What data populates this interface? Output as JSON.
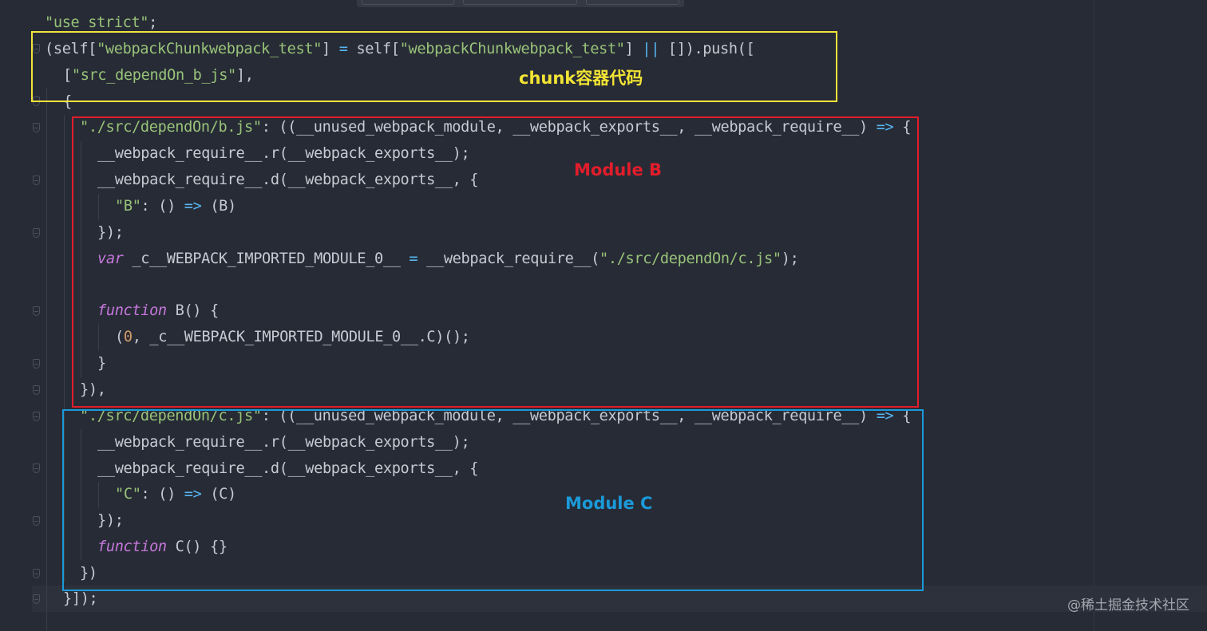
{
  "editor": {
    "lines": [
      [
        {
          "t": "\"use strict\"",
          "c": "str"
        },
        {
          "t": ";",
          "c": ""
        }
      ],
      [
        {
          "t": "(self[",
          "c": ""
        },
        {
          "t": "\"webpackChunkwebpack_test\"",
          "c": "str"
        },
        {
          "t": "] ",
          "c": ""
        },
        {
          "t": "=",
          "c": "op"
        },
        {
          "t": " self[",
          "c": ""
        },
        {
          "t": "\"webpackChunkwebpack_test\"",
          "c": "str"
        },
        {
          "t": "] ",
          "c": ""
        },
        {
          "t": "||",
          "c": "op"
        },
        {
          "t": " []).push([",
          "c": ""
        }
      ],
      [
        {
          "t": "[",
          "c": ""
        },
        {
          "t": "\"src_dependOn_b_js\"",
          "c": "str"
        },
        {
          "t": "],",
          "c": ""
        }
      ],
      [
        {
          "t": "{",
          "c": ""
        }
      ],
      [
        {
          "t": "\"./src/dependOn/b.js\"",
          "c": "str"
        },
        {
          "t": ": ((__unused_webpack_module, __webpack_exports__, __webpack_require__) ",
          "c": ""
        },
        {
          "t": "=>",
          "c": "op"
        },
        {
          "t": " {",
          "c": ""
        }
      ],
      [
        {
          "t": "__webpack_require__.r(__webpack_exports__);",
          "c": ""
        }
      ],
      [
        {
          "t": "__webpack_require__.d(__webpack_exports__, {",
          "c": ""
        }
      ],
      [
        {
          "t": "\"B\"",
          "c": "str"
        },
        {
          "t": ": () ",
          "c": ""
        },
        {
          "t": "=>",
          "c": "op"
        },
        {
          "t": " (B)",
          "c": ""
        }
      ],
      [
        {
          "t": "});",
          "c": ""
        }
      ],
      [
        {
          "t": "var",
          "c": "kw"
        },
        {
          "t": " _c__WEBPACK_IMPORTED_MODULE_0__ ",
          "c": ""
        },
        {
          "t": "=",
          "c": "op"
        },
        {
          "t": " __webpack_require__(",
          "c": ""
        },
        {
          "t": "\"./src/dependOn/c.js\"",
          "c": "str"
        },
        {
          "t": ");",
          "c": ""
        }
      ],
      [],
      [
        {
          "t": "function",
          "c": "kw"
        },
        {
          "t": " B() {",
          "c": ""
        }
      ],
      [
        {
          "t": "(",
          "c": ""
        },
        {
          "t": "0",
          "c": "num"
        },
        {
          "t": ", _c__WEBPACK_IMPORTED_MODULE_0__.C)();",
          "c": ""
        }
      ],
      [
        {
          "t": "}",
          "c": ""
        }
      ],
      [
        {
          "t": "}),",
          "c": ""
        }
      ],
      [
        {
          "t": "\"./src/dependOn/c.js\"",
          "c": "str"
        },
        {
          "t": ": ((__unused_webpack_module, __webpack_exports__, __webpack_require__) ",
          "c": ""
        },
        {
          "t": "=>",
          "c": "op"
        },
        {
          "t": " {",
          "c": ""
        }
      ],
      [
        {
          "t": "__webpack_require__.r(__webpack_exports__);",
          "c": ""
        }
      ],
      [
        {
          "t": "__webpack_require__.d(__webpack_exports__, {",
          "c": ""
        }
      ],
      [
        {
          "t": "\"C\"",
          "c": "str"
        },
        {
          "t": ": () ",
          "c": ""
        },
        {
          "t": "=>",
          "c": "op"
        },
        {
          "t": " (C)",
          "c": ""
        }
      ],
      [
        {
          "t": "});",
          "c": ""
        }
      ],
      [
        {
          "t": "function",
          "c": "kw"
        },
        {
          "t": " C() {}",
          "c": ""
        }
      ],
      [
        {
          "t": "})",
          "c": ""
        }
      ],
      [
        {
          "t": "}]);",
          "c": ""
        }
      ]
    ]
  },
  "annotations": {
    "chunk": "chunk容器代码",
    "module_b": "Module B",
    "module_c": "Module C"
  },
  "colors": {
    "chunk_box": "#f1e33a",
    "module_b_box": "#e21d2b",
    "module_c_box": "#1b9ad9"
  },
  "watermark": "@稀土掘金技术社区"
}
